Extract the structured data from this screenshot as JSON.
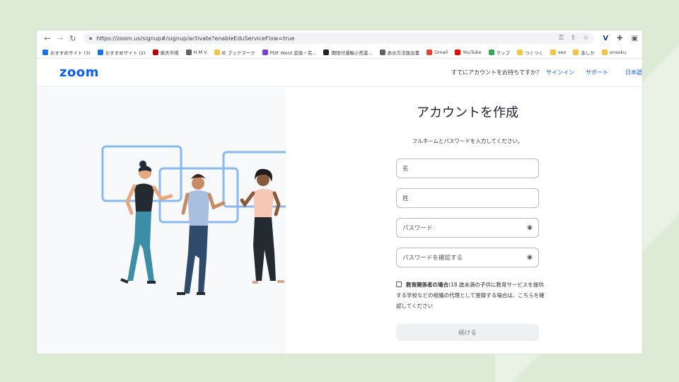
{
  "browser": {
    "url": "https://zoom.us/signup#/signup/activate?enableEduServiceFlow=true",
    "bookmarks": [
      {
        "label": "おすすめサイト (3)",
        "color": "#1a73e8"
      },
      {
        "label": "おすすめサイト (2)",
        "color": "#1a73e8"
      },
      {
        "label": "楽天市場",
        "color": "#bf0000"
      },
      {
        "label": "H M V",
        "color": "#5f6368"
      },
      {
        "label": "IE ブックマーク",
        "color": "#f5c542"
      },
      {
        "label": "PDF Word 変換・完...",
        "color": "#7b3fe4"
      },
      {
        "label": "期限付運輸小売業...",
        "color": "#202124"
      },
      {
        "label": "表示方法届出書",
        "color": "#5f6368"
      },
      {
        "label": "Gmail",
        "color": "#ea4335"
      },
      {
        "label": "YouTube",
        "color": "#ff0000"
      },
      {
        "label": "マップ",
        "color": "#34a853"
      },
      {
        "label": "つくつく",
        "color": "#f5c542"
      },
      {
        "label": "seo",
        "color": "#f5c542"
      },
      {
        "label": "あしか",
        "color": "#f5c542"
      },
      {
        "label": "onsoku",
        "color": "#f5c542"
      }
    ]
  },
  "header": {
    "logo": "zoom",
    "question": "すでにアカウントをお持ちですか？",
    "signin": "サインイン",
    "support": "サポート",
    "language": "日本語"
  },
  "form": {
    "title": "アカウントを作成",
    "subtitle": "フルネームとパスワードを入力してください。",
    "first_name_placeholder": "名",
    "last_name_placeholder": "姓",
    "password_placeholder": "パスワード",
    "confirm_placeholder": "パスワードを確認する",
    "edu_bold": "教育関係者の場合:",
    "edu_text": "18 歳未満の子供に教育サービスを提供する学校などの組織の代理として登録する場合は、こちらを確認してください",
    "continue": "続ける"
  },
  "colors": {
    "brand": "#0b5cff",
    "frame": "#8ab9f1"
  }
}
